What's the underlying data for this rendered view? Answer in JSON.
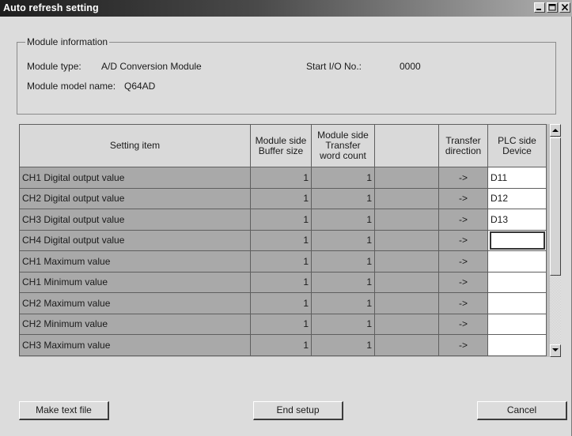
{
  "window": {
    "title": "Auto refresh setting",
    "minimize_label": "_",
    "close_label": "×"
  },
  "module_info": {
    "legend": "Module information",
    "type_label": "Module type:",
    "type_value": "A/D Conversion Module",
    "start_io_label": "Start I/O No.:",
    "start_io_value": "0000",
    "model_label": "Module model name:",
    "model_value": "Q64AD"
  },
  "grid": {
    "headers": {
      "setting_item": "Setting item",
      "buffer_size": [
        "Module side",
        "Buffer size"
      ],
      "transfer_count": [
        "Module side",
        "Transfer",
        "word count"
      ],
      "blank": "",
      "transfer_direction": [
        "Transfer",
        "direction"
      ],
      "plc_device": [
        "PLC side",
        "Device"
      ]
    },
    "rows": [
      {
        "item": "CH1 Digital output value",
        "buffer_size": "1",
        "transfer_count": "1",
        "direction": "->",
        "device": "D11"
      },
      {
        "item": "CH2 Digital output value",
        "buffer_size": "1",
        "transfer_count": "1",
        "direction": "->",
        "device": "D12"
      },
      {
        "item": "CH3 Digital output value",
        "buffer_size": "1",
        "transfer_count": "1",
        "direction": "->",
        "device": "D13"
      },
      {
        "item": "CH4 Digital output value",
        "buffer_size": "1",
        "transfer_count": "1",
        "direction": "->",
        "device": ""
      },
      {
        "item": "CH1 Maximum value",
        "buffer_size": "1",
        "transfer_count": "1",
        "direction": "->",
        "device": ""
      },
      {
        "item": "CH1 Minimum value",
        "buffer_size": "1",
        "transfer_count": "1",
        "direction": "->",
        "device": ""
      },
      {
        "item": "CH2 Maximum value",
        "buffer_size": "1",
        "transfer_count": "1",
        "direction": "->",
        "device": ""
      },
      {
        "item": "CH2 Minimum value",
        "buffer_size": "1",
        "transfer_count": "1",
        "direction": "->",
        "device": ""
      },
      {
        "item": "CH3 Maximum value",
        "buffer_size": "1",
        "transfer_count": "1",
        "direction": "->",
        "device": ""
      }
    ],
    "focused_row": 3
  },
  "buttons": {
    "make_text_file": "Make text file",
    "end_setup": "End setup",
    "cancel": "Cancel"
  }
}
